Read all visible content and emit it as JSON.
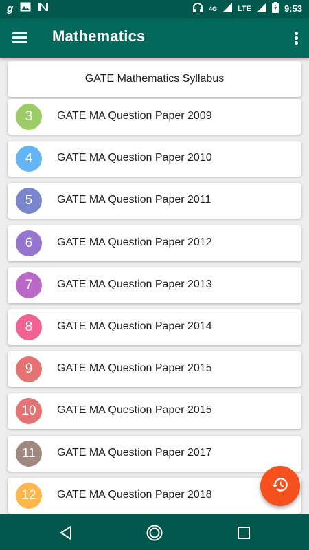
{
  "status_bar": {
    "time": "9:53",
    "network_type": "4G",
    "lte_label": "LTE",
    "icons": [
      "gmail-g-icon",
      "image-icon",
      "n-app-icon",
      "headphones-icon",
      "signal-icon",
      "battery-icon"
    ]
  },
  "app_bar": {
    "title": "Mathematics",
    "menu_icon": "hamburger-menu-icon",
    "more_icon": "more-vert-icon"
  },
  "list": {
    "header": "GATE Mathematics Syllabus",
    "items": [
      {
        "number": "3",
        "label": "GATE MA Question Paper 2009",
        "color": "#9ccc65"
      },
      {
        "number": "4",
        "label": "GATE MA Question Paper 2010",
        "color": "#64b5f6"
      },
      {
        "number": "5",
        "label": "GATE MA Question Paper 2011",
        "color": "#7986cb"
      },
      {
        "number": "6",
        "label": "GATE MA Question Paper 2012",
        "color": "#9575cd"
      },
      {
        "number": "7",
        "label": "GATE MA Question Paper 2013",
        "color": "#ba68c8"
      },
      {
        "number": "8",
        "label": "GATE MA Question Paper 2014",
        "color": "#f06292"
      },
      {
        "number": "9",
        "label": "GATE MA Question Paper 2015",
        "color": "#e57373"
      },
      {
        "number": "10",
        "label": "GATE MA Question Paper 2015",
        "color": "#e57373"
      },
      {
        "number": "11",
        "label": "GATE MA Question Paper 2017",
        "color": "#a1887f"
      },
      {
        "number": "12",
        "label": "GATE MA Question Paper 2018",
        "color": "#ffb74d"
      }
    ]
  },
  "fab": {
    "icon": "history-icon",
    "color": "#f4511e"
  },
  "nav_bar": {
    "icons": [
      "back-icon",
      "home-icon",
      "recents-icon"
    ]
  },
  "colors": {
    "primary": "#00695c",
    "primary_dark": "#00574b"
  }
}
